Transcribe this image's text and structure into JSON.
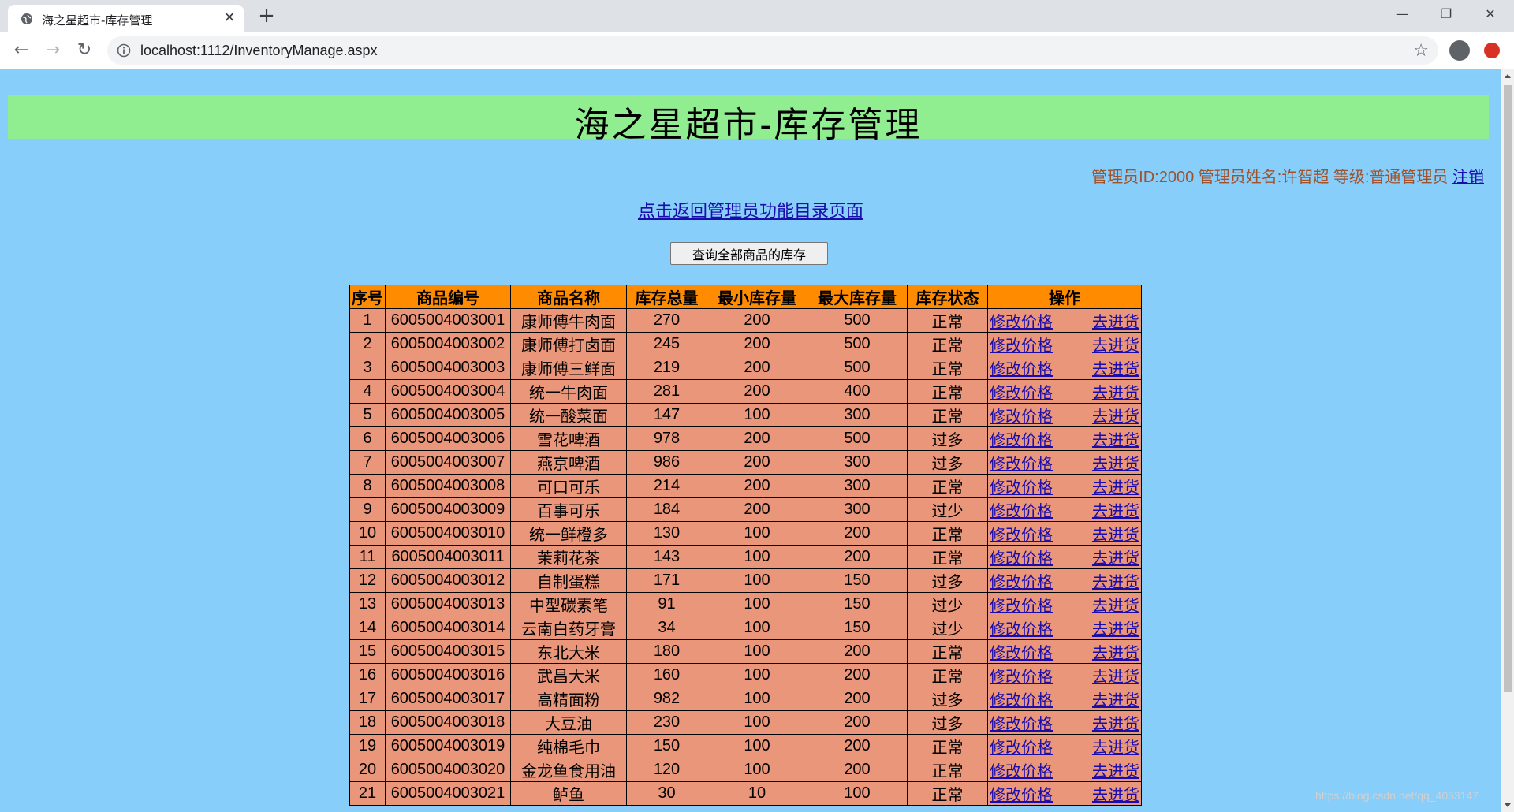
{
  "browser": {
    "tab_title": "海之星超市-库存管理",
    "tab_close": "✕",
    "new_tab": "+",
    "url": "localhost:1112/InventoryManage.aspx",
    "window_controls": {
      "minimize": "—",
      "maximize": "❐",
      "close": "✕"
    },
    "nav": {
      "back": "←",
      "forward": "→",
      "reload": "↻"
    },
    "star": "☆"
  },
  "page": {
    "title": "海之星超市-库存管理",
    "admin_info": "管理员ID:2000 管理员姓名:许智超 等级:普通管理员",
    "logout": "注销",
    "back_link": "点击返回管理员功能目录页面",
    "query_button": "查询全部商品的库存",
    "watermark": "https://blog.csdn.net/qq_4053147"
  },
  "table": {
    "headers": [
      "序号",
      "商品编号",
      "商品名称",
      "库存总量",
      "最小库存量",
      "最大库存量",
      "库存状态",
      "操作"
    ],
    "op_edit": "修改价格",
    "op_restock": "去进货",
    "rows": [
      [
        "1",
        "6005004003001",
        "康师傅牛肉面",
        "270",
        "200",
        "500",
        "正常"
      ],
      [
        "2",
        "6005004003002",
        "康师傅打卤面",
        "245",
        "200",
        "500",
        "正常"
      ],
      [
        "3",
        "6005004003003",
        "康师傅三鲜面",
        "219",
        "200",
        "500",
        "正常"
      ],
      [
        "4",
        "6005004003004",
        "统一牛肉面",
        "281",
        "200",
        "400",
        "正常"
      ],
      [
        "5",
        "6005004003005",
        "统一酸菜面",
        "147",
        "100",
        "300",
        "正常"
      ],
      [
        "6",
        "6005004003006",
        "雪花啤酒",
        "978",
        "200",
        "500",
        "过多"
      ],
      [
        "7",
        "6005004003007",
        "燕京啤酒",
        "986",
        "200",
        "300",
        "过多"
      ],
      [
        "8",
        "6005004003008",
        "可口可乐",
        "214",
        "200",
        "300",
        "正常"
      ],
      [
        "9",
        "6005004003009",
        "百事可乐",
        "184",
        "200",
        "300",
        "过少"
      ],
      [
        "10",
        "6005004003010",
        "统一鲜橙多",
        "130",
        "100",
        "200",
        "正常"
      ],
      [
        "11",
        "6005004003011",
        "茉莉花茶",
        "143",
        "100",
        "200",
        "正常"
      ],
      [
        "12",
        "6005004003012",
        "自制蛋糕",
        "171",
        "100",
        "150",
        "过多"
      ],
      [
        "13",
        "6005004003013",
        "中型碳素笔",
        "91",
        "100",
        "150",
        "过少"
      ],
      [
        "14",
        "6005004003014",
        "云南白药牙膏",
        "34",
        "100",
        "150",
        "过少"
      ],
      [
        "15",
        "6005004003015",
        "东北大米",
        "180",
        "100",
        "200",
        "正常"
      ],
      [
        "16",
        "6005004003016",
        "武昌大米",
        "160",
        "100",
        "200",
        "正常"
      ],
      [
        "17",
        "6005004003017",
        "高精面粉",
        "982",
        "100",
        "200",
        "过多"
      ],
      [
        "18",
        "6005004003018",
        "大豆油",
        "230",
        "100",
        "200",
        "过多"
      ],
      [
        "19",
        "6005004003019",
        "纯棉毛巾",
        "150",
        "100",
        "200",
        "正常"
      ],
      [
        "20",
        "6005004003020",
        "金龙鱼食用油",
        "120",
        "100",
        "200",
        "正常"
      ],
      [
        "21",
        "6005004003021",
        "鲈鱼",
        "30",
        "10",
        "100",
        "正常"
      ]
    ]
  }
}
